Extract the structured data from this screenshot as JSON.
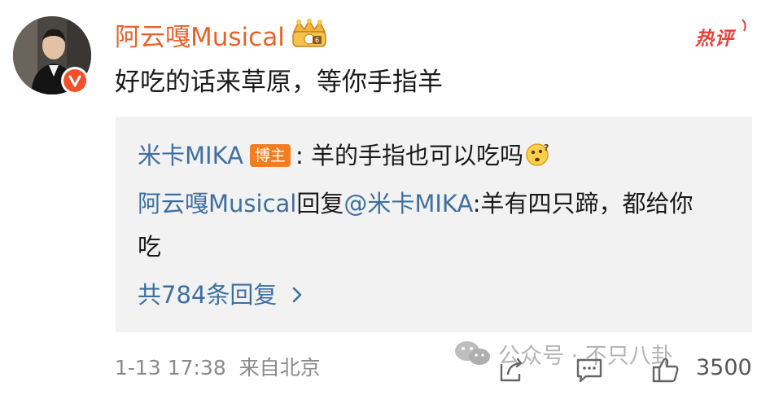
{
  "post": {
    "username": "阿云嘎Musical",
    "text": "好吃的话来草原，等你手指羊",
    "hot_badge": "热评",
    "time": "1-13 17:38",
    "location": "来自北京",
    "like_count": "3500"
  },
  "replies": {
    "first": {
      "author": "米卡MIKA",
      "badge": "博主",
      "separator": ": ",
      "text": "羊的手指也可以吃吗"
    },
    "second": {
      "author": "阿云嘎Musical",
      "action": "回复",
      "mention": "@米卡MIKA",
      "text_line1": ":羊有四只蹄，都给你",
      "text_line2": "吃"
    },
    "more": "共784条回复"
  },
  "watermark": {
    "text": "公众号 · 不只八卦"
  },
  "colors": {
    "username": "#e8622a",
    "link_blue": "#3e6fa1",
    "hot_red": "#e8403a",
    "badge_orange": "#f37d22",
    "panel_bg": "#f2f2f2",
    "meta_gray": "#8a8a8a"
  },
  "icons": {
    "verify": "verified-v-icon",
    "crown": "crown-fan-badge-icon",
    "emoji": "thinking-face-icon",
    "chevron": "chevron-right-icon",
    "share": "share-icon",
    "comment": "comment-icon",
    "like": "thumbs-up-icon",
    "wechat": "wechat-logo-icon"
  }
}
